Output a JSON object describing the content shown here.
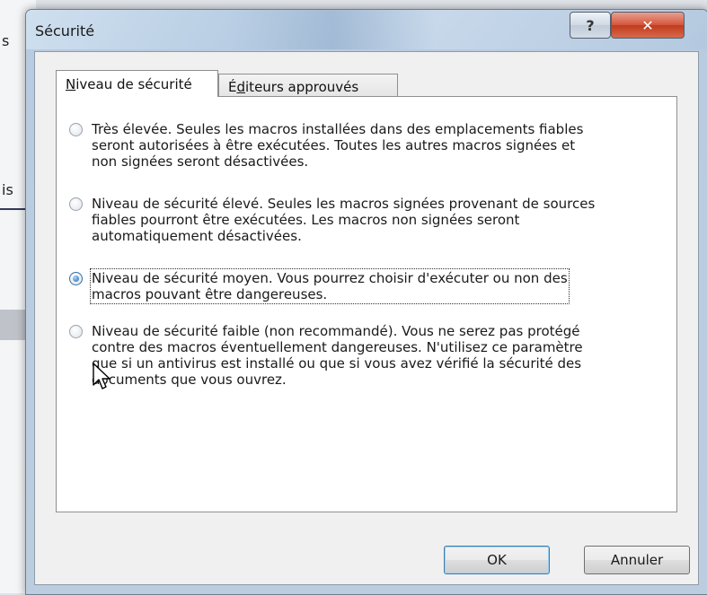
{
  "background": {
    "fragment_top": "s",
    "fragment_mid": "is"
  },
  "dialog": {
    "title": "Sécurité",
    "help_symbol": "?",
    "close_symbol": "✕"
  },
  "tabs": [
    {
      "label_mnemonic": "N",
      "label_rest": "iveau de sécurité",
      "active": true
    },
    {
      "label_pre": "É",
      "label_mnemonic": "d",
      "label_rest": "iteurs approuvés",
      "active": false
    }
  ],
  "options": [
    {
      "text": "Très élevée. Seules les macros installées dans des emplacements fiables\nseront autorisées à être exécutées. Toutes les autres macros signées et\nnon signées seront désactivées.",
      "checked": false
    },
    {
      "text": "Niveau de sécurité élevé. Seules les macros signées provenant de sources\nfiables pourront être exécutées. Les macros non signées seront\nautomatiquement désactivées.",
      "checked": false
    },
    {
      "text": "Niveau de sécurité moyen. Vous pourrez choisir d'exécuter ou non des\nmacros pouvant être dangereuses.",
      "checked": true
    },
    {
      "text": "Niveau de sécurité faible (non recommandé). Vous ne serez pas protégé\ncontre des macros éventuellement dangereuses. N'utilisez ce paramètre\nque si un antivirus est installé ou que si vous avez vérifié la sécurité des\ndocuments que vous ouvrez.",
      "checked": false
    }
  ],
  "buttons": {
    "ok": "OK",
    "cancel": "Annuler"
  },
  "colors": {
    "window_frame": "#b9cbe0",
    "close_button": "#c23a1d",
    "radio_selected": "#1f64b0"
  }
}
